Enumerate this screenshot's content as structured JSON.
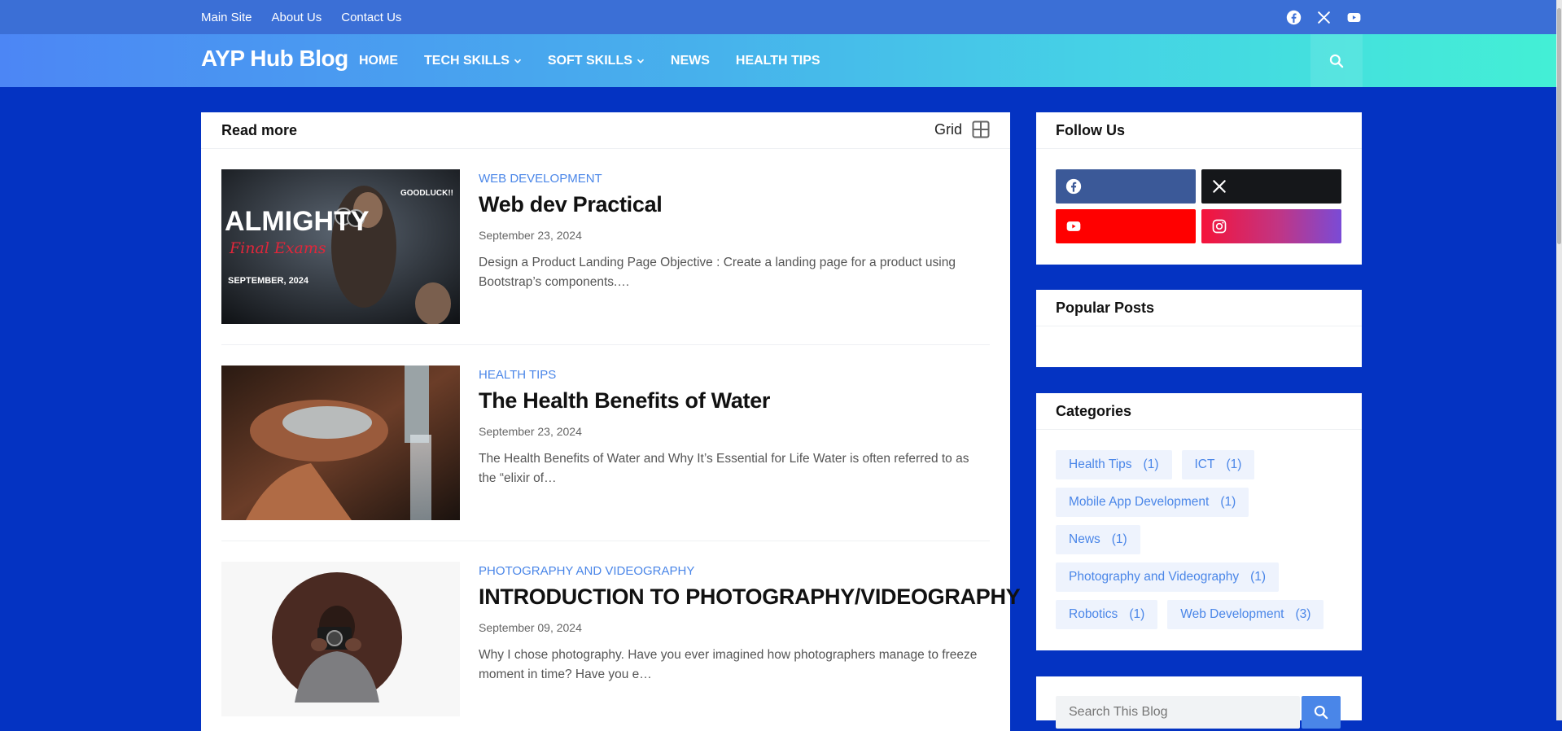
{
  "topbar": {
    "links": [
      "Main Site",
      "About Us",
      "Contact Us"
    ],
    "social_icons": [
      "facebook-icon",
      "x-icon",
      "youtube-icon"
    ]
  },
  "nav": {
    "brand": "AYP Hub Blog",
    "items": [
      {
        "label": "HOME",
        "dropdown": false
      },
      {
        "label": "TECH SKILLS",
        "dropdown": true
      },
      {
        "label": "SOFT SKILLS",
        "dropdown": true
      },
      {
        "label": "NEWS",
        "dropdown": false
      },
      {
        "label": "HEALTH TIPS",
        "dropdown": false
      }
    ],
    "search_icon": "search-icon"
  },
  "main": {
    "title": "Read more",
    "view_label": "Grid",
    "posts": [
      {
        "category": "WEB DEVELOPMENT",
        "title": "Web dev Practical",
        "date": "September 23, 2024",
        "snippet": "Design a Product Landing Page Objective : Create a landing page for a product using Bootstrap’s components.…",
        "thumb_text": {
          "headline": "ALMIGHTY",
          "sub": "Final Exams",
          "corner": "GOODLUCK!!",
          "footer": "SEPTEMBER, 2024"
        }
      },
      {
        "category": "HEALTH TIPS",
        "title": "The Health Benefits of Water",
        "date": "September 23, 2024",
        "snippet": "The Health Benefits of Water and Why It’s Essential for Life Water is often referred to as the “elixir of…"
      },
      {
        "category": "PHOTOGRAPHY AND VIDEOGRAPHY",
        "title": "INTRODUCTION TO PHOTOGRAPHY/VIDEOGRAPHY",
        "date": "September 09, 2024",
        "snippet": "Why I chose photography. Have you ever imagined how photographers manage to freeze moment in time? Have you e…"
      }
    ]
  },
  "sidebar": {
    "follow": {
      "title": "Follow Us",
      "buttons": [
        {
          "icon": "facebook-icon",
          "color": "#3b5998"
        },
        {
          "icon": "x-icon",
          "color": "#15171a"
        },
        {
          "icon": "youtube-icon",
          "color": "#ff0000"
        },
        {
          "icon": "instagram-icon",
          "color": "#e1306c"
        }
      ]
    },
    "popular": {
      "title": "Popular Posts"
    },
    "categories": {
      "title": "Categories",
      "items": [
        {
          "label": "Health Tips",
          "count": "(1)"
        },
        {
          "label": "ICT",
          "count": "(1)"
        },
        {
          "label": "Mobile App Development",
          "count": "(1)"
        },
        {
          "label": "News",
          "count": "(1)"
        },
        {
          "label": "Photography and Videography",
          "count": "(1)"
        },
        {
          "label": "Robotics",
          "count": "(1)"
        },
        {
          "label": "Web Development",
          "count": "(3)"
        }
      ]
    },
    "search": {
      "placeholder": "Search This Blog"
    }
  },
  "colors": {
    "page_bg": "#0433c2",
    "accent": "#4a86e8",
    "topbar": "#3b6fd6"
  }
}
